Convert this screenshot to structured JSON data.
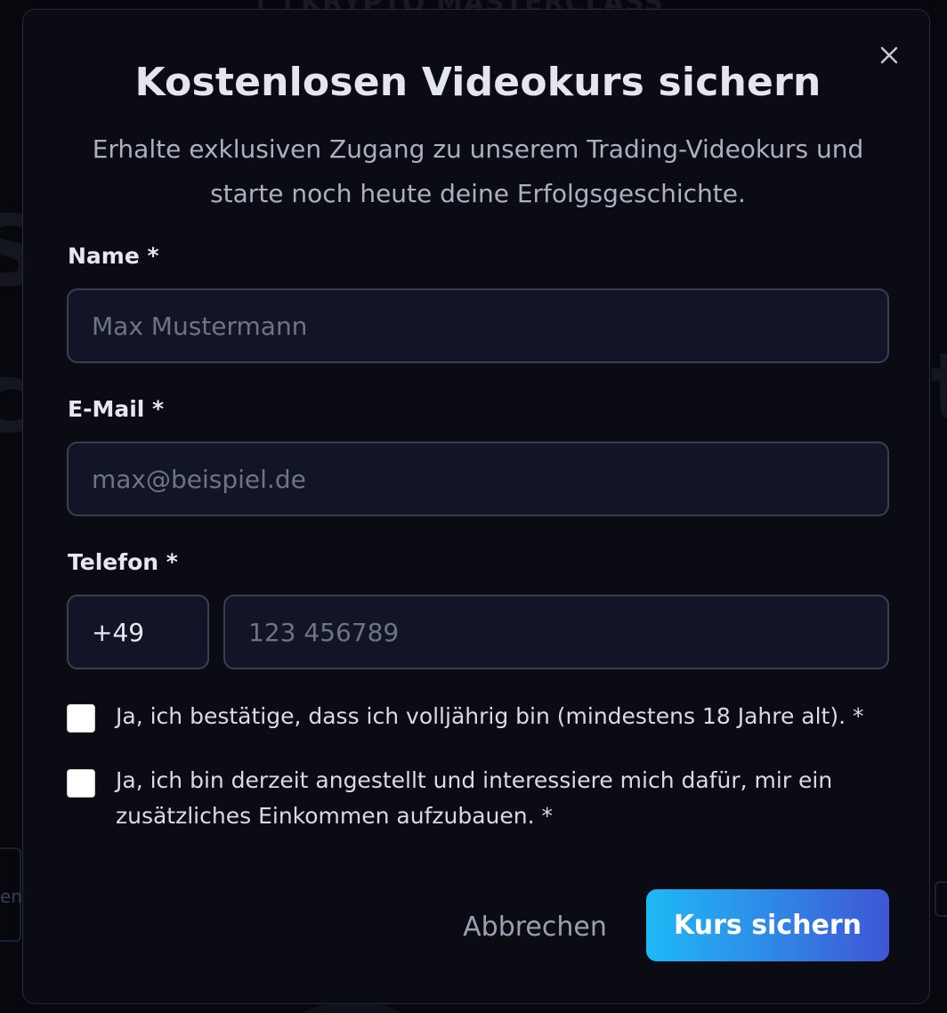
{
  "background": {
    "brand_text": "KRYPTO MASTERCLASS",
    "side_text": "en"
  },
  "modal": {
    "title": "Kostenlosen Videokurs sichern",
    "subtitle": "Erhalte exklusiven Zugang zu unserem Trading-Videokurs und starte noch heute deine Erfolgsgeschichte.",
    "close_icon": "close-icon"
  },
  "form": {
    "name": {
      "label": "Name *",
      "value": "",
      "placeholder": "Max Mustermann"
    },
    "email": {
      "label": "E-Mail *",
      "value": "",
      "placeholder": "max@beispiel.de"
    },
    "phone": {
      "label": "Telefon *",
      "country_code": "+49",
      "value": "",
      "placeholder": "123 456789"
    },
    "checkboxes": [
      {
        "label": "Ja, ich bestätige, dass ich volljährig bin (mindestens 18 Jahre alt). *",
        "checked": false
      },
      {
        "label": "Ja, ich bin derzeit angestellt und interessiere mich dafür, mir ein zusätzliches Einkommen aufzubauen. *",
        "checked": false
      }
    ]
  },
  "actions": {
    "cancel_label": "Abbrechen",
    "submit_label": "Kurs sichern",
    "submit_gradient": [
      "#1fb8f6",
      "#3f56d5"
    ]
  },
  "colors": {
    "modal_bg": "#0b0c13",
    "input_bg": "#111527",
    "input_border": "#3a3f4f",
    "title": "#e4e6ef",
    "subtitle": "#aab0c1"
  }
}
